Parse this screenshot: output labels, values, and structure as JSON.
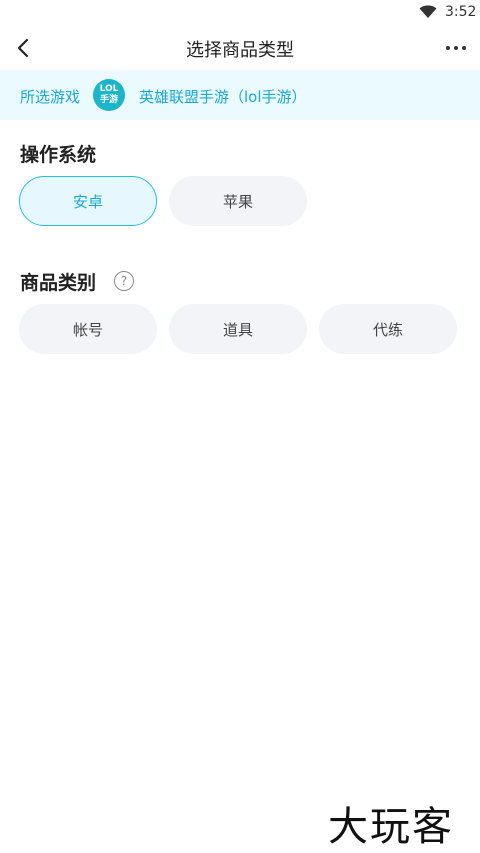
{
  "status_bar": {
    "time": "3:52"
  },
  "nav": {
    "title": "选择商品类型"
  },
  "game": {
    "label": "所选游戏",
    "logo_line1": "LOL",
    "logo_line2": "手游",
    "name": "英雄联盟手游（lol手游）"
  },
  "os_section": {
    "title": "操作系统",
    "options": [
      "安卓",
      "苹果"
    ],
    "selected": "安卓"
  },
  "category_section": {
    "title": "商品类别",
    "options": [
      "帐号",
      "道具",
      "代练"
    ]
  },
  "watermark": "大玩客",
  "colors": {
    "accent": "#1aa9d4",
    "chip_bg": "#f3f4f7",
    "strip_bg": "#eafaff"
  }
}
